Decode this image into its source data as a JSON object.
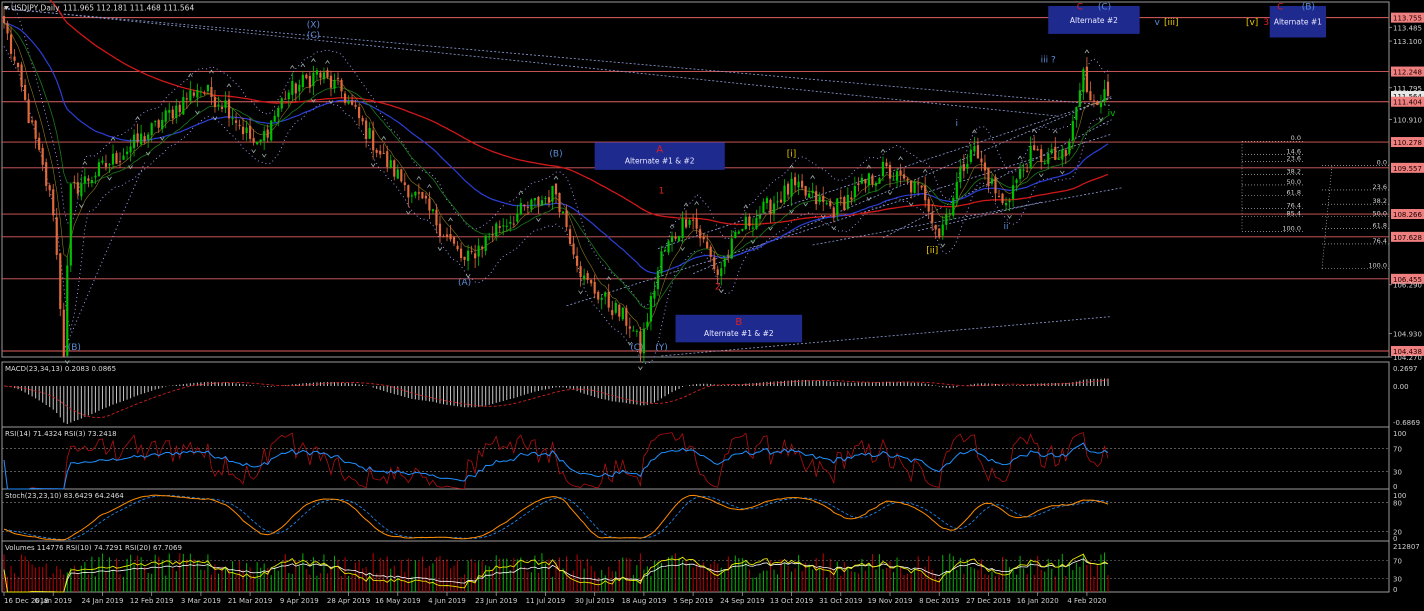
{
  "header": {
    "title": "USDJPY,Daily",
    "ohlc": "111.965 112.181 111.468 111.564"
  },
  "colors": {
    "background": "#000000",
    "bull_candle": "#00c000",
    "bear_candle": "#e06a3c",
    "ma_red": "#d01818",
    "ma_blue": "#2b3fd6",
    "hline": "#e06060",
    "channel": "#8fa0d8",
    "box_fill": "#1f2a8f",
    "macd_bar": "#c8c8c8",
    "rsi_red": "#b01010",
    "rsi_blue": "#1e90ff",
    "stoch_orange": "#ff8c00",
    "vol_green": "#00b000",
    "vol_red": "#c00000",
    "vol_yellow": "#e8e800"
  },
  "main": {
    "price_axis": [
      {
        "label": "113.755",
        "price": 113.755,
        "box": true
      },
      {
        "label": "113.485",
        "price": 113.485,
        "box": false
      },
      {
        "label": "113.100",
        "price": 113.1,
        "box": false
      },
      {
        "label": "112.248",
        "price": 112.248,
        "box": true
      },
      {
        "label": "111.795",
        "price": 111.795,
        "box": false
      },
      {
        "label": "111.564",
        "price": 111.564,
        "box": true,
        "current": true
      },
      {
        "label": "111.404",
        "price": 111.404,
        "box": true
      },
      {
        "label": "110.910",
        "price": 110.91,
        "box": false
      },
      {
        "label": "110.278",
        "price": 110.278,
        "box": true
      },
      {
        "label": "109.557",
        "price": 109.557,
        "box": true
      },
      {
        "label": "108.266",
        "price": 108.266,
        "box": true
      },
      {
        "label": "107.628",
        "price": 107.628,
        "box": true
      },
      {
        "label": "106.455",
        "price": 106.455,
        "box": true
      },
      {
        "label": "106.290",
        "price": 106.29,
        "box": false
      },
      {
        "label": "104.930",
        "price": 104.93,
        "box": false
      },
      {
        "label": "104.438",
        "price": 104.438,
        "box": true
      },
      {
        "label": "104.270",
        "price": 104.27,
        "box": false
      }
    ],
    "wave_labels": [
      {
        "text": "(X)",
        "date_index": 88,
        "price": 113.48,
        "color": "#5b8cd6"
      },
      {
        "text": "(C)",
        "date_index": 88,
        "price": 113.18,
        "color": "#5b8cd6"
      },
      {
        "text": "(B)",
        "date_index": 157,
        "price": 109.87,
        "color": "#5b8cd6"
      },
      {
        "text": "(A)",
        "date_index": 131,
        "price": 106.28,
        "color": "#5b8cd6"
      },
      {
        "text": "(B)",
        "date_index": 20,
        "price": 104.47,
        "color": "#5b8cd6"
      },
      {
        "text": "(C)",
        "date_index": 180,
        "price": 104.47,
        "color": "#5b8cd6"
      },
      {
        "text": "(Y)",
        "date_index": 187,
        "price": 104.47,
        "color": "#5b8cd6"
      },
      {
        "text": "1",
        "date_index": 187,
        "price": 108.84,
        "color": "#e02020"
      },
      {
        "text": "2",
        "date_index": 203,
        "price": 106.15,
        "color": "#e02020"
      },
      {
        "text": "[i]",
        "date_index": 224,
        "price": 109.88,
        "color": "#e8c800"
      },
      {
        "text": "[ii]",
        "date_index": 264,
        "price": 107.18,
        "color": "#e8c800"
      },
      {
        "text": "i",
        "date_index": 271,
        "price": 110.73,
        "color": "#5b8cd6"
      },
      {
        "text": "ii",
        "date_index": 285,
        "price": 107.85,
        "color": "#5b8cd6"
      },
      {
        "text": "iii ?",
        "date_index": 297,
        "price": 112.5,
        "color": "#5b8cd6"
      },
      {
        "text": "iv",
        "date_index": 315,
        "price": 111.0,
        "color": "#00c000"
      },
      {
        "text": "v",
        "date_index": 328,
        "price": 113.55,
        "color": "#5b8cd6"
      },
      {
        "text": "[iii]",
        "date_index": 332,
        "price": 113.55,
        "color": "#e8c800"
      },
      {
        "text": "[v]",
        "date_index": 355,
        "price": 113.55,
        "color": "#e8c800"
      },
      {
        "text": "3",
        "date_index": 359,
        "price": 113.55,
        "color": "#e02020"
      },
      {
        "text": "C",
        "date_index": 306,
        "price": 113.98,
        "color": "#e02020"
      },
      {
        "text": "(C)",
        "date_index": 313,
        "price": 113.98,
        "color": "#5b8cd6"
      },
      {
        "text": "C",
        "date_index": 363,
        "price": 113.98,
        "color": "#e02020"
      },
      {
        "text": "(B)",
        "date_index": 371,
        "price": 113.98,
        "color": "#5b8cd6"
      }
    ],
    "boxes": [
      {
        "title": "A",
        "subtitle": "Alternate #1 & #2",
        "title_color": "#e02020",
        "x0": 168,
        "x1": 205,
        "p_top": 110.27,
        "p_bot": 109.5
      },
      {
        "title": "B",
        "subtitle": "Alternate #1 & #2",
        "title_color": "#e02020",
        "x0": 191,
        "x1": 227,
        "p_top": 105.45,
        "p_bot": 104.68
      },
      {
        "title": "",
        "subtitle": "Alternate #2",
        "title_color": "#e02020",
        "x0": 297,
        "x1": 323,
        "p_top": 114.08,
        "p_bot": 113.3
      },
      {
        "title": "",
        "subtitle": "Alternate #1",
        "title_color": "#e02020",
        "x0": 360,
        "x1": 376,
        "p_top": 114.08,
        "p_bot": 113.2
      }
    ],
    "fib_levels": [
      {
        "label": "0.0",
        "price": 110.3,
        "group": 1
      },
      {
        "label": "14.6",
        "price": 109.93,
        "group": 1
      },
      {
        "label": "23.6",
        "price": 109.73,
        "group": 1
      },
      {
        "label": "38.2",
        "price": 109.37,
        "group": 1
      },
      {
        "label": "50.0",
        "price": 109.08,
        "group": 1
      },
      {
        "label": "61.8",
        "price": 108.78,
        "group": 1
      },
      {
        "label": "76.4",
        "price": 108.42,
        "group": 1
      },
      {
        "label": "85.4",
        "price": 108.2,
        "group": 1
      },
      {
        "label": "100.0",
        "price": 107.78,
        "group": 1
      },
      {
        "label": "0.0",
        "price": 109.62,
        "group": 2
      },
      {
        "label": "23.6",
        "price": 108.94,
        "group": 2
      },
      {
        "label": "38.2",
        "price": 108.54,
        "group": 2
      },
      {
        "label": "50.0",
        "price": 108.19,
        "group": 2
      },
      {
        "label": "61.8",
        "price": 107.86,
        "group": 2
      },
      {
        "label": "76.4",
        "price": 107.43,
        "group": 2
      },
      {
        "label": "100.0",
        "price": 106.74,
        "group": 2
      }
    ],
    "date_axis": [
      {
        "label": "16 Dec 2018",
        "index": 0
      },
      {
        "label": "6 Jan 2019",
        "index": 14
      },
      {
        "label": "24 Jan 2019",
        "index": 28
      },
      {
        "label": "12 Feb 2019",
        "index": 42
      },
      {
        "label": "3 Mar 2019",
        "index": 56
      },
      {
        "label": "21 Mar 2019",
        "index": 70
      },
      {
        "label": "9 Apr 2019",
        "index": 84
      },
      {
        "label": "28 Apr 2019",
        "index": 98
      },
      {
        "label": "16 May 2019",
        "index": 112
      },
      {
        "label": "4 Jun 2019",
        "index": 126
      },
      {
        "label": "23 Jun 2019",
        "index": 140
      },
      {
        "label": "11 Jul 2019",
        "index": 154
      },
      {
        "label": "30 Jul 2019",
        "index": 168
      },
      {
        "label": "18 Aug 2019",
        "index": 182
      },
      {
        "label": "5 Sep 2019",
        "index": 196
      },
      {
        "label": "24 Sep 2019",
        "index": 210
      },
      {
        "label": "13 Oct 2019",
        "index": 224
      },
      {
        "label": "31 Oct 2019",
        "index": 238
      },
      {
        "label": "19 Nov 2019",
        "index": 252
      },
      {
        "label": "8 Dec 2019",
        "index": 266
      },
      {
        "label": "27 Dec 2019",
        "index": 280
      },
      {
        "label": "16 Jan 2020",
        "index": 294
      },
      {
        "label": "4 Feb 2020",
        "index": 308
      }
    ]
  },
  "macd": {
    "title": "MACD(23,34,13) 0.2083 0.0865",
    "axis": [
      "0.2697",
      "0.00",
      "-0.6869"
    ]
  },
  "rsi": {
    "title": "RSI(14) 71.4324  RSI(3) 73.2418",
    "axis": [
      "100",
      "70",
      "30",
      "0"
    ]
  },
  "stoch": {
    "title": "Stoch(23,23,10) 83.6429 64.2464",
    "axis": [
      "100",
      "80",
      "20",
      "0"
    ]
  },
  "volumes": {
    "title": "Volumes 114776  RSI(10) 74.7291  RSI(20) 67.7069",
    "axis": [
      "212807",
      "70",
      "30",
      "0"
    ]
  },
  "chart_data": {
    "type": "candlestick",
    "symbol": "USDJPY",
    "timeframe": "Daily",
    "x_range": [
      "16 Dec 2018",
      "14 Feb 2020"
    ],
    "y_range": [
      104.27,
      114.08
    ],
    "grid": false,
    "key_points": [
      {
        "index": 0,
        "close": 113.6
      },
      {
        "index": 4,
        "close": 112.1
      },
      {
        "index": 14,
        "close": 108.4
      },
      {
        "index": 17,
        "close": 104.44
      },
      {
        "index": 19,
        "close": 108.9
      },
      {
        "index": 30,
        "close": 109.7
      },
      {
        "index": 42,
        "close": 110.6
      },
      {
        "index": 55,
        "close": 111.8
      },
      {
        "index": 63,
        "close": 111.35
      },
      {
        "index": 72,
        "close": 110.1
      },
      {
        "index": 80,
        "close": 111.6
      },
      {
        "index": 89,
        "close": 112.2
      },
      {
        "index": 96,
        "close": 111.7
      },
      {
        "index": 108,
        "close": 109.8
      },
      {
        "index": 122,
        "close": 108.2
      },
      {
        "index": 131,
        "close": 106.9
      },
      {
        "index": 140,
        "close": 107.9
      },
      {
        "index": 157,
        "close": 108.9
      },
      {
        "index": 165,
        "close": 106.4
      },
      {
        "index": 178,
        "close": 105.2
      },
      {
        "index": 181,
        "close": 104.5
      },
      {
        "index": 187,
        "close": 107.1
      },
      {
        "index": 195,
        "close": 108.3
      },
      {
        "index": 203,
        "close": 106.6
      },
      {
        "index": 210,
        "close": 107.9
      },
      {
        "index": 224,
        "close": 109.0
      },
      {
        "index": 236,
        "close": 108.4
      },
      {
        "index": 250,
        "close": 109.5
      },
      {
        "index": 262,
        "close": 108.8
      },
      {
        "index": 266,
        "close": 107.7
      },
      {
        "index": 275,
        "close": 110.2
      },
      {
        "index": 284,
        "close": 108.5
      },
      {
        "index": 292,
        "close": 109.9
      },
      {
        "index": 302,
        "close": 109.8
      },
      {
        "index": 307,
        "close": 112.2
      },
      {
        "index": 308,
        "close": 111.56
      }
    ],
    "last": {
      "open": 111.965,
      "high": 112.181,
      "low": 111.468,
      "close": 111.564
    }
  }
}
